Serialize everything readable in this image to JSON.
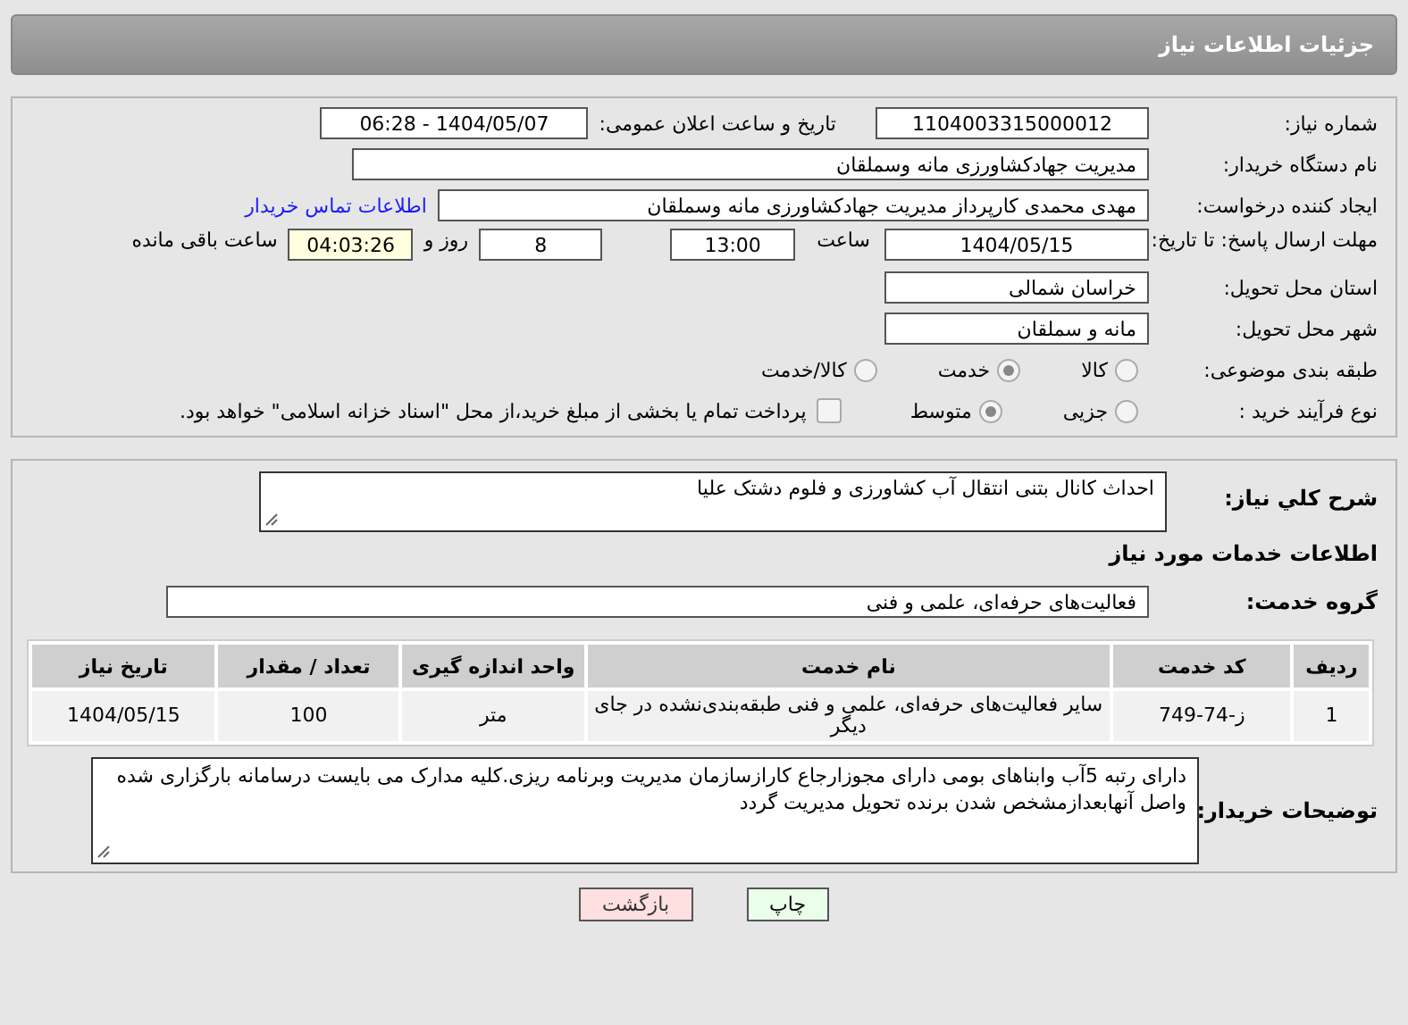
{
  "header": {
    "title": "جزئیات اطلاعات نیاز"
  },
  "need_number": {
    "label": "شماره نیاز:",
    "value": "1104003315000012"
  },
  "announce": {
    "label": "تاریخ و ساعت اعلان عمومی:",
    "value": "1404/05/07 - 06:28"
  },
  "buyer_org": {
    "label": "نام دستگاه خریدار:",
    "value": "مدیریت جهادکشاورزی مانه وسملقان"
  },
  "requester": {
    "label": "ایجاد کننده درخواست:",
    "value": "مهدی  محمدی کارپرداز مدیریت جهادکشاورزی مانه وسملقان",
    "link": "اطلاعات تماس خریدار"
  },
  "deadline": {
    "label": "مهلت ارسال پاسخ: تا تاریخ:",
    "date": "1404/05/15",
    "time_label": "ساعت",
    "time": "13:00",
    "days": "8",
    "days_label": "روز و",
    "remaining": "04:03:26",
    "remaining_label": "ساعت باقی مانده"
  },
  "province": {
    "label": "استان محل تحویل:",
    "value": "خراسان شمالی"
  },
  "city": {
    "label": "شهر محل تحویل:",
    "value": "مانه و سملقان"
  },
  "category": {
    "label": "طبقه بندی موضوعی:",
    "options": [
      {
        "label": "کالا",
        "selected": false
      },
      {
        "label": "خدمت",
        "selected": true
      },
      {
        "label": "کالا/خدمت",
        "selected": false
      }
    ]
  },
  "purchase_type": {
    "label": "نوع فرآیند خرید :",
    "options": [
      {
        "label": "جزیی",
        "selected": false
      },
      {
        "label": "متوسط",
        "selected": true
      }
    ],
    "checkbox": {
      "label": "پرداخت تمام یا بخشی از مبلغ خرید،از محل \"اسناد خزانه اسلامی\" خواهد بود.",
      "checked": false
    }
  },
  "description": {
    "label": "شرح کلي نیاز:",
    "value": "احداث کانال بتنی انتقال آب کشاورزی و فلوم دشتک علیا"
  },
  "services_title": "اطلاعات خدمات مورد نیاز",
  "service_group": {
    "label": "گروه خدمت:",
    "value": "فعالیت‌های حرفه‌ای، علمی و فنی"
  },
  "table": {
    "columns": [
      "ردیف",
      "کد خدمت",
      "نام خدمت",
      "واحد اندازه گیری",
      "تعداد / مقدار",
      "تاریخ نیاز"
    ],
    "rows": [
      [
        "1",
        "ز-74-749",
        "سایر فعالیت‌های حرفه‌ای، علمی و فنی طبقه‌بندی‌نشده در جای دیگر",
        "متر",
        "100",
        "1404/05/15"
      ]
    ]
  },
  "buyer_notes": {
    "label": "توضیحات خریدار:",
    "value": "دارای رتبه 5آب وابناهای بومی دارای مجوزارجاع کارازسازمان مدیریت وبرنامه ریزی.کلیه مدارک می بایست درسامانه بارگزاری شده واصل آنهابعدازمشخص شدن برنده تحویل مدیریت گردد"
  },
  "buttons": [
    {
      "label": "چاپ",
      "kind": "print"
    },
    {
      "label": "بازگشت",
      "kind": "back"
    }
  ]
}
